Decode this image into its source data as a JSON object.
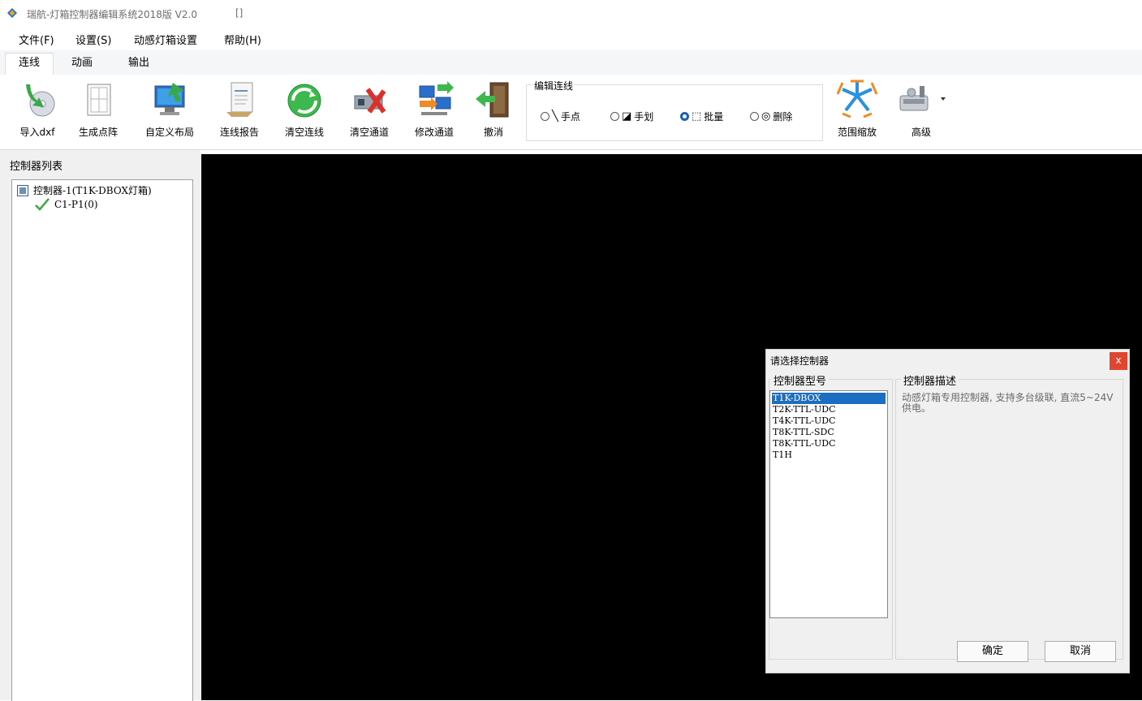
{
  "window": {
    "title": "瑞航-灯箱控制器编辑系统2018版 V2.0",
    "title_extra": "[]"
  },
  "menu": [
    {
      "label": "文件(F)"
    },
    {
      "label": "设置(S)"
    },
    {
      "label": "动感灯箱设置"
    },
    {
      "label": "帮助(H)"
    }
  ],
  "tabs": [
    {
      "label": "连线",
      "active": true
    },
    {
      "label": "动画"
    },
    {
      "label": "输出"
    }
  ],
  "ribbon": {
    "buttons": [
      {
        "label": "导入dxf",
        "icon": "import-dxf-icon"
      },
      {
        "label": "生成点阵",
        "icon": "generate-dots-icon"
      },
      {
        "label": "自定义布局",
        "icon": "custom-layout-icon"
      },
      {
        "label": "连线报告",
        "icon": "report-icon"
      },
      {
        "label": "清空连线",
        "icon": "clear-lines-icon"
      },
      {
        "label": "清空通道",
        "icon": "clear-channel-icon"
      },
      {
        "label": "修改通道",
        "icon": "modify-channel-icon"
      },
      {
        "label": "撤消",
        "icon": "undo-icon"
      }
    ],
    "edit_group": {
      "title": "编辑连线",
      "options": [
        {
          "label": "手点",
          "glyph": "╲",
          "selected": false
        },
        {
          "label": "手划",
          "glyph": "◪",
          "selected": false
        },
        {
          "label": "批量",
          "glyph": "⬚",
          "selected": true
        },
        {
          "label": "删除",
          "glyph": "◎",
          "selected": false
        }
      ]
    },
    "zoom_button": {
      "label": "范围缩放",
      "icon": "zoom-range-icon"
    },
    "advanced_button": {
      "label": "高级",
      "icon": "advanced-icon"
    }
  },
  "left_panel": {
    "title": "控制器列表",
    "tree": {
      "controller": "控制器-1(T1K-DBOX灯箱)",
      "port": "C1-P1(0)"
    }
  },
  "dialog": {
    "title": "请选择控制器",
    "close": "x",
    "model_label": "控制器型号",
    "desc_label": "控制器描述",
    "models": [
      "T1K-DBOX",
      "T2K-TTL-UDC",
      "T4K-TTL-UDC",
      "T8K-TTL-SDC",
      "T8K-TTL-UDC",
      "T1H"
    ],
    "selected_model": "T1K-DBOX",
    "description": "动感灯箱专用控制器, 支持多台级联, 直流5~24V供电。",
    "ok": "确定",
    "cancel": "取消"
  },
  "colors": {
    "canvas": "#000000",
    "selection": "#1b6ec2",
    "close_button": "#e0452e"
  }
}
